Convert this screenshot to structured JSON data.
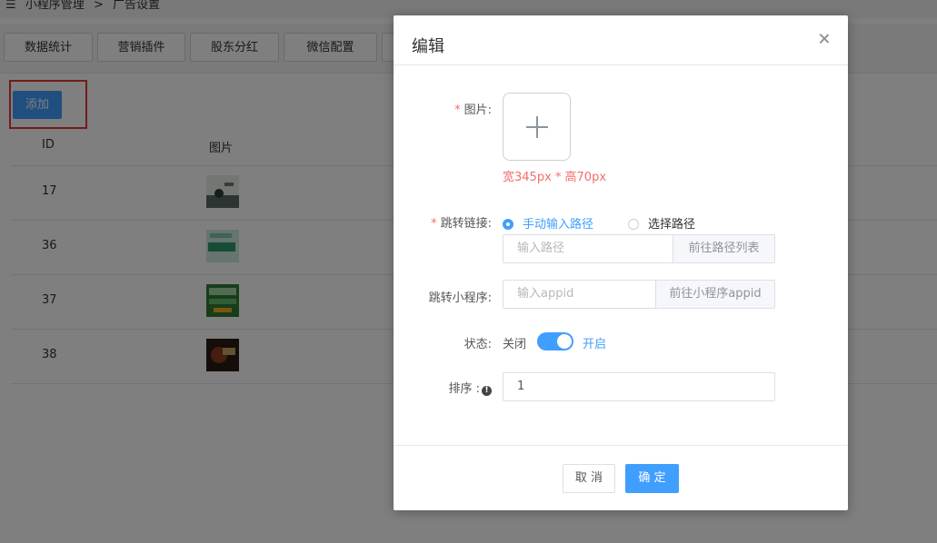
{
  "breadcrumb": {
    "part1": "小程序管理",
    "separator": ">",
    "part2": "广告设置"
  },
  "tabs": [
    "数据统计",
    "营销插件",
    "股东分红",
    "微信配置"
  ],
  "add_button": "添加",
  "table": {
    "headers": [
      "ID",
      "图片"
    ],
    "rows": [
      {
        "id": "17"
      },
      {
        "id": "36"
      },
      {
        "id": "37"
      },
      {
        "id": "38"
      }
    ]
  },
  "dialog": {
    "title": "编辑",
    "image": {
      "label": "图片:",
      "hint": "宽345px * 高70px"
    },
    "jump_link": {
      "label": "跳转链接:",
      "option_manual": "手动输入路径",
      "option_select": "选择路径",
      "placeholder": "输入路径",
      "append_button": "前往路径列表"
    },
    "mini_program": {
      "label": "跳转小程序:",
      "placeholder": "输入appid",
      "append_button": "前往小程序appid"
    },
    "status": {
      "label": "状态:",
      "off_text": "关闭",
      "on_text": "开启",
      "enabled": true
    },
    "sort": {
      "label": "排序 :",
      "value": "1"
    },
    "cancel": "取 消",
    "confirm": "确 定"
  },
  "colors": {
    "primary": "#409eff",
    "danger": "#f56c6c",
    "highlight_box": "#e53935"
  }
}
